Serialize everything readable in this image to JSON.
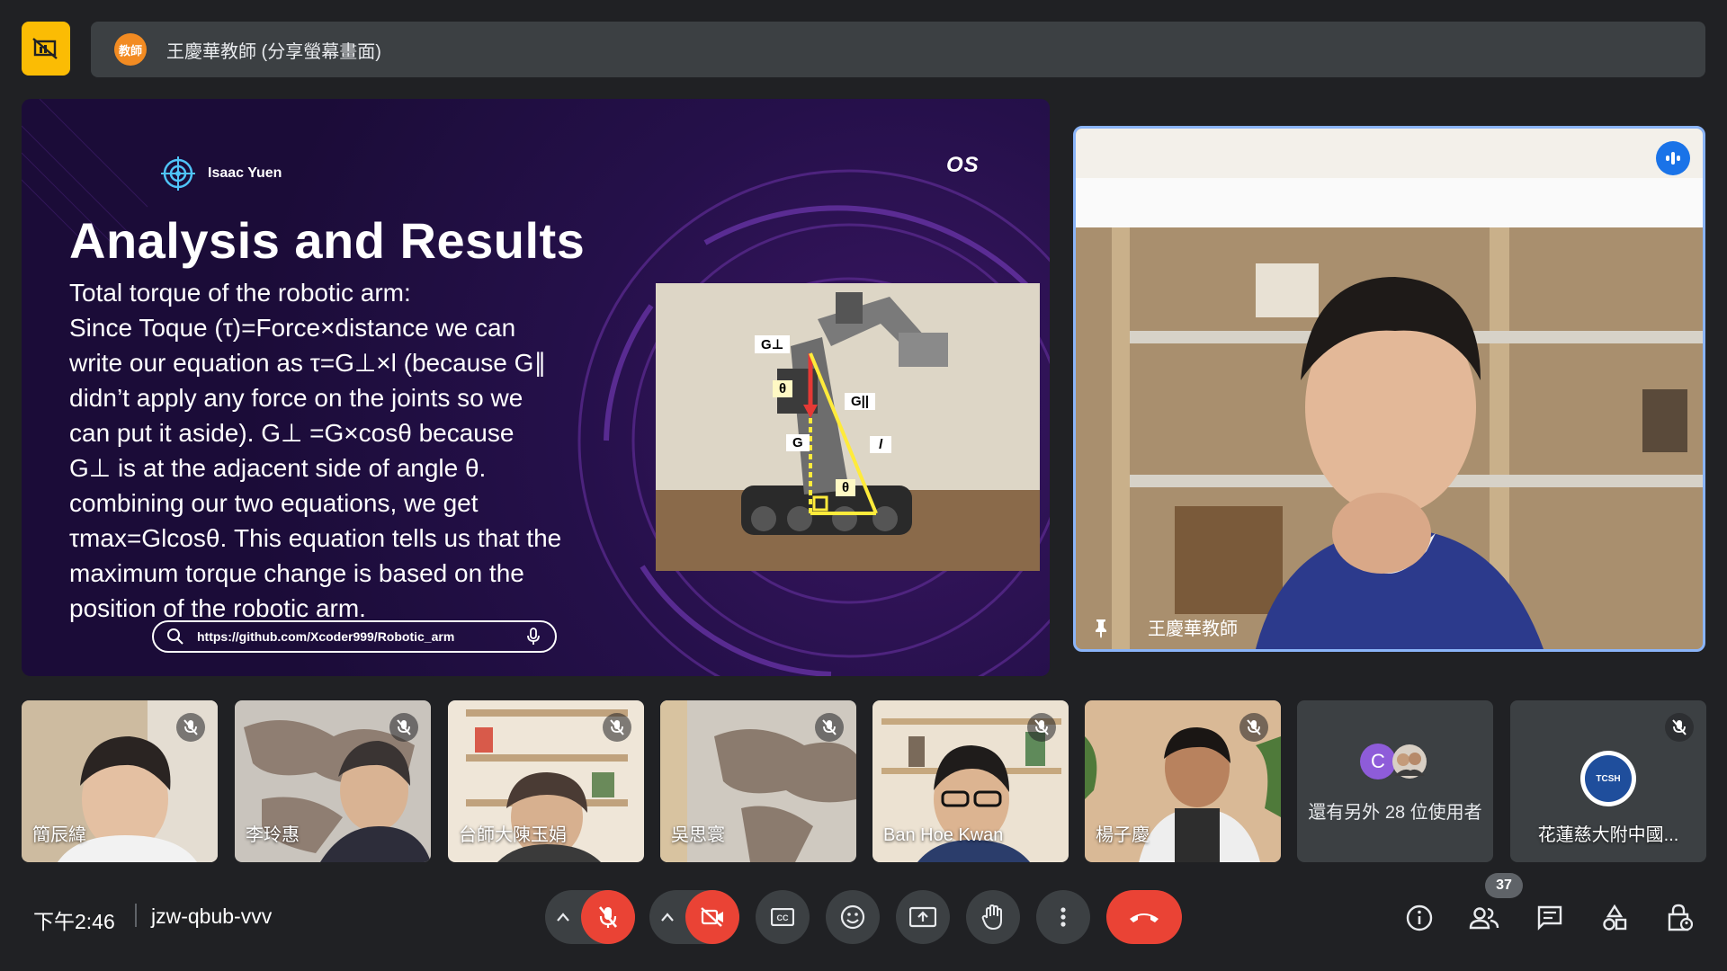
{
  "header": {
    "presenter_badge": "教師",
    "present_title": "王慶華教師 (分享螢幕畫面)",
    "present_icon": "presentation-off-icon"
  },
  "slide": {
    "author": "Isaac Yuen",
    "logo": "OS",
    "title": "Analysis and Results",
    "body_lines": [
      "Total torque of the robotic arm:",
      "Since Toque (τ)=Force×distance we can",
      "write our equation as τ=G⊥×l (because G∥",
      "didn’t apply any force on the joints so we",
      "can put it aside). G⊥ =G×cosθ because",
      "G⊥ is at the adjacent side of angle θ.",
      "combining our two equations, we get",
      "τmax=Glcosθ. This equation tells us that the",
      "maximum torque change is based on the",
      "position of the robotic arm."
    ],
    "diagram_labels": {
      "g_perp": "G⊥",
      "theta1": "θ",
      "g_par": "G||",
      "g": "G",
      "l": "l",
      "theta2": "θ"
    },
    "search_url": "https://github.com/Xcoder999/Robotic_arm"
  },
  "main_tile": {
    "name": "王慶華教師",
    "speaking_icon": "audio-level-icon"
  },
  "participants": [
    {
      "name": "簡辰緯",
      "muted": true
    },
    {
      "name": "李玲惠",
      "muted": true
    },
    {
      "name": "台師大陳玉娟",
      "muted": true
    },
    {
      "name": "吳思寰",
      "muted": true
    },
    {
      "name": "Ban Hoe Kwan",
      "muted": true
    },
    {
      "name": "楊子慶",
      "muted": true
    }
  ],
  "others_tile": {
    "avatar_letter": "C",
    "label": "還有另外 28 位使用者"
  },
  "school_tile": {
    "name": "花蓮慈大附中國...",
    "logo_text": "TCSH",
    "muted": true
  },
  "bottom_bar": {
    "time": "下午2:46",
    "meeting_code": "jzw-qbub-vvv",
    "participant_count": "37"
  },
  "colors": {
    "background": "#202124",
    "tile": "#3c4043",
    "danger": "#ea4335",
    "accent_blue": "#8ab4f8",
    "present_yellow": "#fbbc04"
  }
}
